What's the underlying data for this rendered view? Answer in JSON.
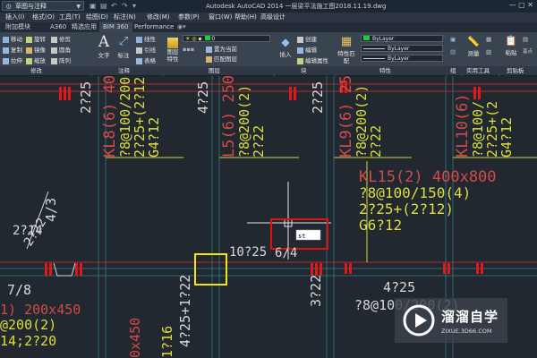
{
  "titlebar": {
    "workspace": "草图与注释",
    "title": "Autodesk AutoCAD 2014  一层梁平法施工图2018.11.19.dwg"
  },
  "menubar": [
    "插入(I)",
    "格式(O)",
    "工具(T)",
    "绘图(D)",
    "标注(N)",
    "修改(M)",
    "参数(P)",
    "窗口(W)",
    "帮助(H)",
    "高级设计"
  ],
  "tabs": [
    "附加模块",
    "A360",
    "精选应用",
    "BIM 360",
    "Performance"
  ],
  "ribbon": {
    "modify": [
      "移动",
      "旋转",
      "修剪",
      "复制",
      "镜像",
      "圆角",
      "拉伸",
      "缩放",
      "阵列"
    ],
    "annotation": [
      "文字",
      "标注",
      "线性",
      "引线",
      "表格"
    ],
    "layers": [
      "图层特性",
      "置为当前",
      "匹配图层"
    ],
    "block": [
      "插入",
      "创建",
      "编辑",
      "编辑属性"
    ],
    "properties": [
      "特性匹配",
      "ByLayer",
      "ByLayer",
      "ByLayer"
    ],
    "right": [
      "测量",
      "粘贴",
      "基点"
    ],
    "panels": [
      "修改",
      "注释",
      "图层",
      "块",
      "特性",
      "组",
      "实用工具",
      "剪贴板"
    ]
  },
  "drawing": {
    "texts": [
      {
        "t": "2?25",
        "color": "#d8d8d8"
      },
      {
        "t": "KL8(6) 40",
        "color": "#d24a4a"
      },
      {
        "t": "?8@100/200(2)",
        "color": "#dede3a"
      },
      {
        "t": "2?25+(2?12)",
        "color": "#dede3a"
      },
      {
        "t": "G4?12",
        "color": "#dede3a"
      },
      {
        "t": "4?25",
        "color": "#d8d8d8"
      },
      {
        "t": "L5(6) 250",
        "color": "#d24a4a"
      },
      {
        "t": "?8@200(2)",
        "color": "#dede3a"
      },
      {
        "t": "2?22",
        "color": "#dede3a"
      },
      {
        "t": "2?25",
        "color": "#d8d8d8"
      },
      {
        "t": "KL9(6) 25",
        "color": "#d24a4a"
      },
      {
        "t": "?8@200(2)",
        "color": "#dede3a"
      },
      {
        "t": "2?22",
        "color": "#dede3a"
      },
      {
        "t": "KL10(6)",
        "color": "#d24a4a"
      },
      {
        "t": "?8@100/",
        "color": "#dede3a"
      },
      {
        "t": "2?25+(2",
        "color": "#dede3a"
      },
      {
        "t": "G4?12",
        "color": "#dede3a"
      },
      {
        "t": "KL15(2) 400x800",
        "color": "#d24a4a"
      },
      {
        "t": "?8@100/150(4)",
        "color": "#dede3a"
      },
      {
        "t": "2?25+(2?12)",
        "color": "#dede3a"
      },
      {
        "t": "G6?12",
        "color": "#dede3a"
      },
      {
        "t": "4/3",
        "color": "#d8d8d8"
      },
      {
        "t": "2?14",
        "color": "#d8d8d8"
      },
      {
        "t": "2?22",
        "color": "#d8d8d8"
      },
      {
        "t": "10?25",
        "color": "#d8d8d8"
      },
      {
        "t": "6/4",
        "color": "#d8d8d8"
      },
      {
        "t": "st",
        "color": "#000000"
      },
      {
        "t": "7/8",
        "color": "#d8d8d8"
      },
      {
        "t": "1) 200x450",
        "color": "#d24a4a"
      },
      {
        "t": "@200(2)",
        "color": "#dede3a"
      },
      {
        "t": "14;2?20",
        "color": "#dede3a"
      },
      {
        "t": "4?25+1?22",
        "color": "#d8d8d8"
      },
      {
        "t": "3?22",
        "color": "#d8d8d8"
      },
      {
        "t": "4?25",
        "color": "#d8d8d8"
      },
      {
        "t": "?8@100/200(2)",
        "color": "#d8d8d8"
      },
      {
        "t": "1?16",
        "color": "#dede3a"
      },
      {
        "t": "0x450",
        "color": "#d24a4a"
      }
    ]
  },
  "watermark": {
    "name": "溜溜自学",
    "url": "ZIXUE.3D66.COM"
  }
}
